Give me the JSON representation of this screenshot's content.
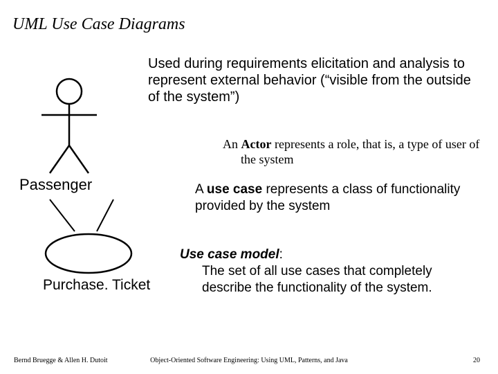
{
  "title": "UML Use Case Diagrams",
  "intro": "Used during requirements elicitation and analysis to represent external behavior (“visible from the outside of the system”)",
  "actor_def_prefix": "An ",
  "actor_def_bold": "Actor",
  "actor_def_rest": " represents a role, that is, a type of user of the system",
  "actor_label": "Passenger",
  "usecase_def_prefix": "A ",
  "usecase_def_bold": "use case",
  "usecase_def_rest": " represents a class of functionality provided by the system",
  "model_head": "Use case model",
  "model_colon": ":",
  "model_body": "The set of all use cases that completely describe the functionality of the  system.",
  "usecase_label": "Purchase. Ticket",
  "footer_left": "Bernd Bruegge & Allen H. Dutoit",
  "footer_center": "Object-Oriented Software Engineering: Using UML, Patterns, and Java",
  "footer_right": "20"
}
